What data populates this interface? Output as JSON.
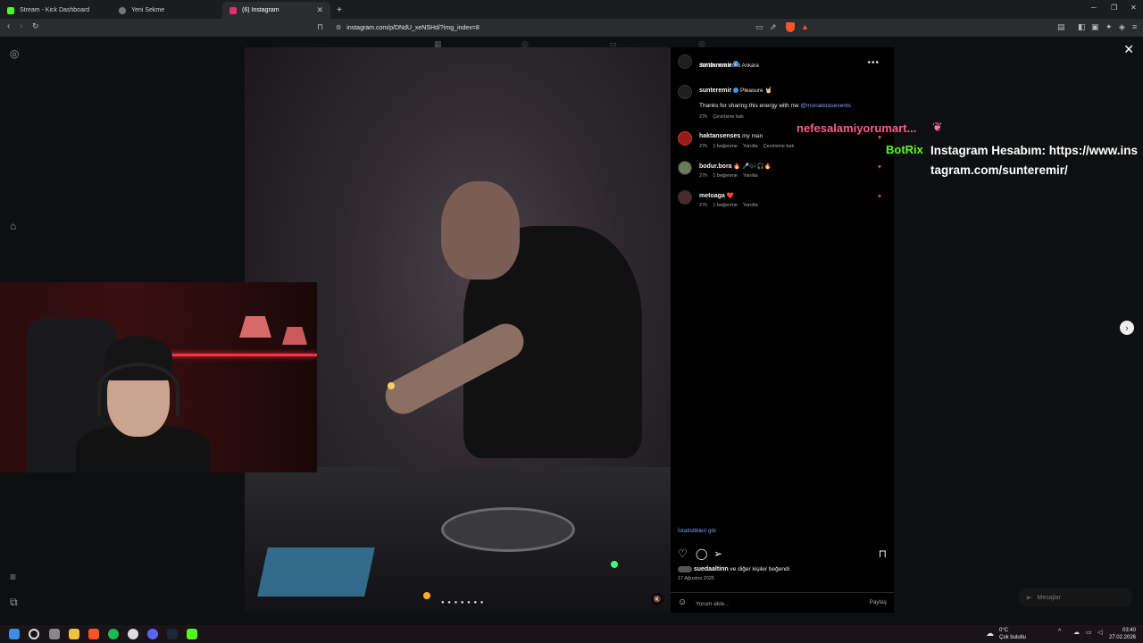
{
  "browser": {
    "tabs": [
      {
        "label": "Stream - Kick Dashboard",
        "color": "#53fc18"
      },
      {
        "label": "Yeni Sekme",
        "color": "#888888"
      },
      {
        "label": "(6) Instagram",
        "color": "#e1306c",
        "active": true
      }
    ],
    "url": "instagram.com/p/DNdU_xeNSHd/?img_index=8",
    "notification_count": "6"
  },
  "post": {
    "username": "sunteremir",
    "location": "JW Marriott Hotel Ankara",
    "caption_user": "sunteremir",
    "caption_text": "Pleasure 🤘🏻",
    "caption_line2_prefix": "Thanks for sharing this energy with me",
    "caption_mention": "@monaterasevents",
    "caption_meta_time": "27h",
    "caption_meta_translate": "Çevirisine bak",
    "comments": [
      {
        "user": "haktansenses",
        "text": "my man",
        "time": "27h",
        "likes": "1 beğenme",
        "reply": "Yanıtla",
        "translate": "Çevirisine bak"
      },
      {
        "user": "bodur.bora",
        "text": "🔥 🎤🎶🎧🔥",
        "time": "27h",
        "likes": "1 beğenme",
        "reply": "Yanıtla"
      },
      {
        "user": "metoaga",
        "text": "❤️",
        "time": "27h",
        "likes": "1 beğenme",
        "reply": "Yanıtla"
      }
    ],
    "stats_link": "İstatistikleri gör",
    "liked_by_user": "suedaaltinn",
    "liked_by_rest": "ve diğer kişiler beğendi",
    "date": "17 Ağustos 2025",
    "comment_placeholder": "Yorum ekle...",
    "share_label": "Paylaş"
  },
  "chat": {
    "user1": "nefesalamiyorumart...",
    "bot_name": "BotRix",
    "bot_message": "Instagram Hesabım: https://www.instagram.com/sunteremir/"
  },
  "messages_label": "Mesajlar",
  "taskbar": {
    "weather_temp": "0°C",
    "weather_desc": "Çok bulutlu",
    "time": "03:40",
    "date": "27.02.2026"
  },
  "colors": {
    "instagram_link": "#7b9eff",
    "kick_green": "#53fc18",
    "like_red": "#ed4956"
  }
}
